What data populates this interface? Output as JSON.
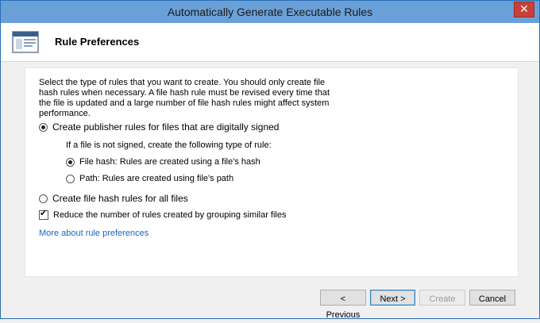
{
  "window": {
    "title": "Automatically Generate Executable Rules",
    "close_glyph": "✕"
  },
  "header": {
    "heading": "Rule Preferences",
    "icon": "window-icon"
  },
  "content": {
    "description": "Select the type of rules that you want to create. You should only create file hash rules when necessary. A file hash rule must be revised every time that the file is updated and a large number of file hash rules might affect system performance.",
    "option_publisher": "Create publisher rules for files that are digitally signed",
    "unsigned_label": "If a file is not signed, create the following type of rule:",
    "option_file_hash": "File hash: Rules are created using a file's hash",
    "option_path": "Path: Rules are created using file's path",
    "option_all_hash": "Create file hash rules for all files",
    "reduce_label": "Reduce the number of rules created by grouping similar files",
    "more_link": "More about rule preferences"
  },
  "footer": {
    "previous": "< Previous",
    "next": "Next >",
    "create": "Create",
    "cancel": "Cancel"
  },
  "colors": {
    "titlebar": "#6aa0d8",
    "link": "#1a66c2",
    "close": "#c84039"
  }
}
